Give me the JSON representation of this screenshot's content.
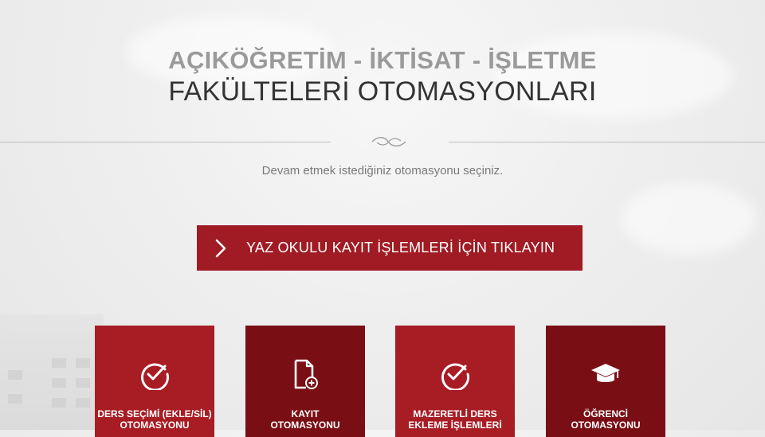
{
  "header": {
    "title_line1": "AÇIKÖĞRETİM - İKTİSAT - İŞLETME",
    "title_line2": "FAKÜLTELERİ OTOMASYONLARI",
    "subtitle": "Devam etmek istediğiniz otomasyonu seçiniz."
  },
  "cta": {
    "label": "YAZ OKULU KAYIT İŞLEMLERİ İÇİN TIKLAYIN",
    "icon": "chevron-right-icon"
  },
  "cards": [
    {
      "line1": "DERS SEÇİMİ (EKLE/SİL)",
      "line2": "OTOMASYONU",
      "icon": "check-circle-icon",
      "color": "#a81c24"
    },
    {
      "line1": "KAYIT",
      "line2": "OTOMASYONU",
      "icon": "document-add-icon",
      "color": "#7a0e15"
    },
    {
      "line1": "MAZERETLİ DERS",
      "line2": "EKLEME İŞLEMLERİ",
      "icon": "check-circle-icon",
      "color": "#a81c24"
    },
    {
      "line1": "ÖĞRENCİ",
      "line2": "OTOMASYONU",
      "icon": "graduation-cap-icon",
      "color": "#7a0e15"
    }
  ],
  "colors": {
    "primary_red": "#a01b23",
    "dark_red": "#7a0e15",
    "title_gray": "#9a9a9a",
    "title_dark": "#333333"
  }
}
